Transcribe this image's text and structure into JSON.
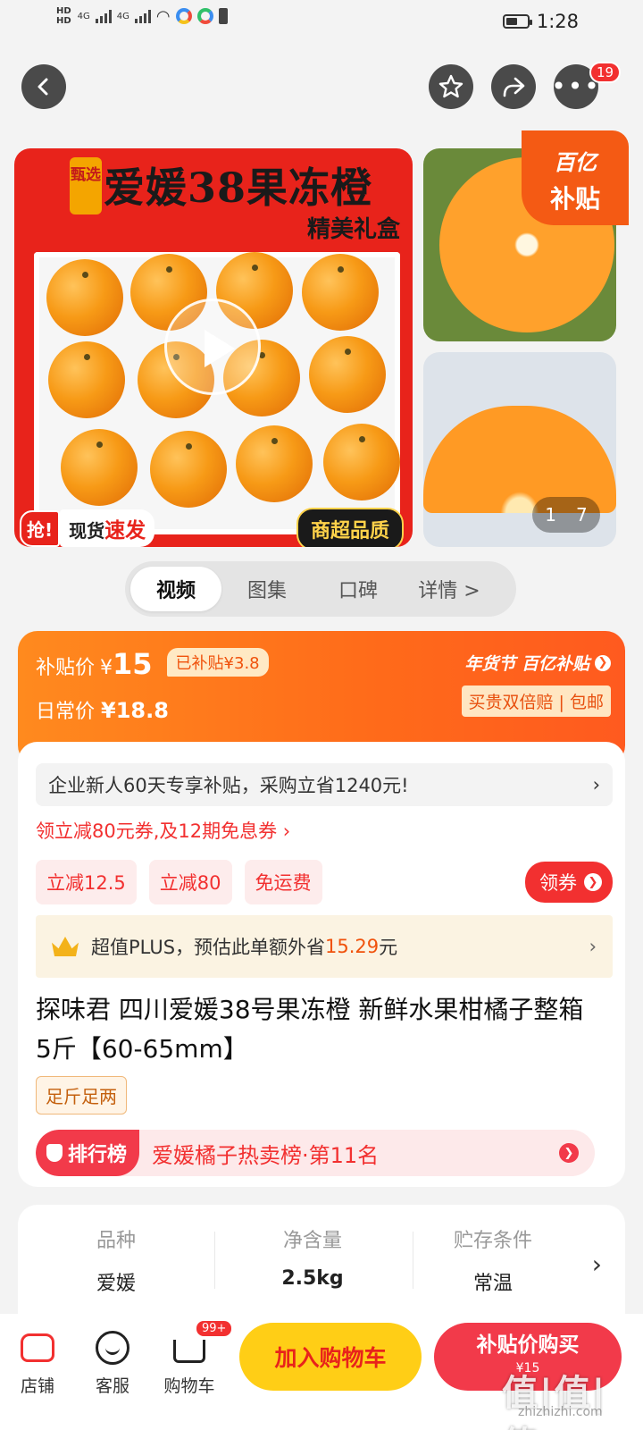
{
  "status_bar": {
    "network_left": "HD",
    "network_left2": "HD",
    "network_type": "4G",
    "network_type2": "4G",
    "time": "1:28"
  },
  "top_nav": {
    "more_badge": "19"
  },
  "gallery": {
    "banner_tag": "甄选",
    "banner_title": "爱媛38果冻橙",
    "banner_subtitle": "精美礼盒",
    "rush_label": "抢!",
    "fast_label_prefix": "现货",
    "fast_label_emph": "速发",
    "quality_label": "商超品质",
    "subsidy_tag_line1": "百亿",
    "subsidy_tag_line2": "补贴",
    "page_current": "1",
    "page_total": "7"
  },
  "tabs": [
    "视频",
    "图集",
    "口碑",
    "详情 >"
  ],
  "price": {
    "subsidy_label": "补贴价",
    "currency": "¥",
    "subsidy_price": "15",
    "subsidized_amount": "已补贴¥3.8",
    "regular_label": "日常价",
    "regular_price": "¥18.8",
    "program_label": "年货节 百亿补贴",
    "guarantee": "买贵双倍赔 | 包邮"
  },
  "promo": {
    "new_user_text": "企业新人60天专享补贴，采购立省1240元!",
    "coupon_line": "领立减80元券,及12期免息券 ›",
    "chips": [
      "立减12.5",
      "立减80",
      "免运费"
    ],
    "get_coupon": "领券",
    "plus_text_prefix": "超值PLUS，预估此单额外省",
    "plus_amount": "15.29",
    "plus_unit": "元"
  },
  "product": {
    "title": "探味君 四川爱媛38号果冻橙 新鲜水果柑橘子整箱 5斤【60-65mm】",
    "tag": "足斤足两",
    "rank_badge": "排行榜",
    "rank_text": "爱媛橘子热卖榜·第11名"
  },
  "specs": [
    {
      "key": "品种",
      "value": "爱媛"
    },
    {
      "key": "净含量",
      "value": "2.5kg"
    },
    {
      "key": "贮存条件",
      "value": "常温"
    }
  ],
  "bottom_bar": {
    "shop": "店铺",
    "service": "客服",
    "cart": "购物车",
    "cart_badge": "99+",
    "add_to_cart": "加入购物车",
    "buy_now": "补贴价购买",
    "buy_price": "¥15"
  },
  "watermark": {
    "main": "值|值|值",
    "sub": "zhizhizhi.com"
  },
  "colors": {
    "accent_red": "#f23030",
    "orange": "#ff6a1a",
    "yellow": "#ffce16"
  }
}
